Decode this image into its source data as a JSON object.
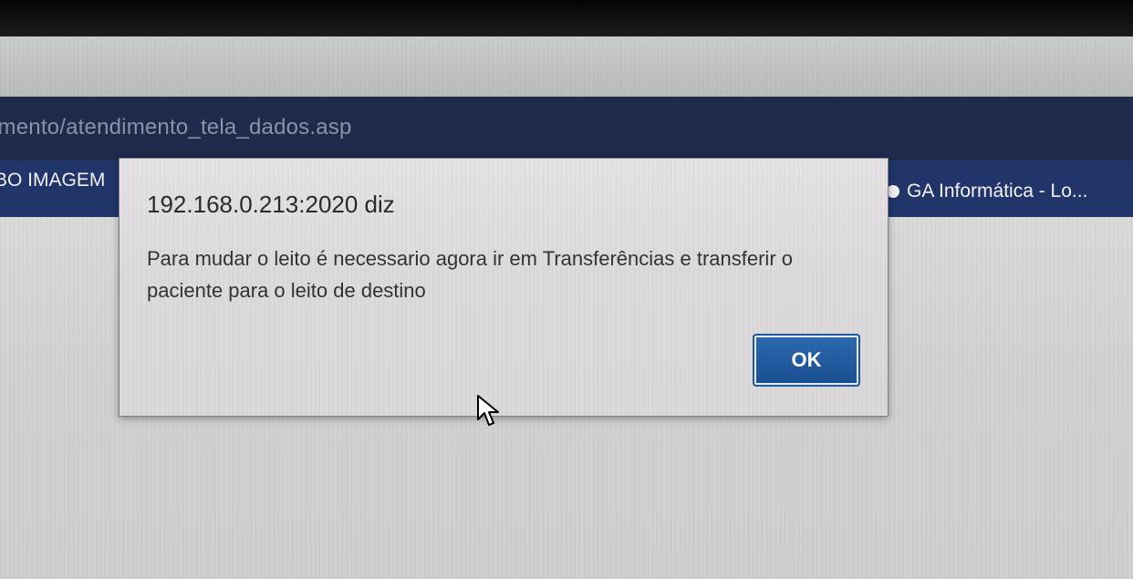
{
  "browser": {
    "address": "imento/atendimento_tela_dados.asp",
    "bookmarks": {
      "left": "BO IMAGEM",
      "right": "GA Informática - Lo..."
    }
  },
  "dialog": {
    "title": "192.168.0.213:2020 diz",
    "message": "Para mudar o leito é necessario agora ir em Transferências e transferir o paciente para o leito de destino",
    "ok_label": "OK"
  },
  "icons": {
    "bookmark": "globe-icon",
    "cursor": "mouse-pointer-icon"
  }
}
